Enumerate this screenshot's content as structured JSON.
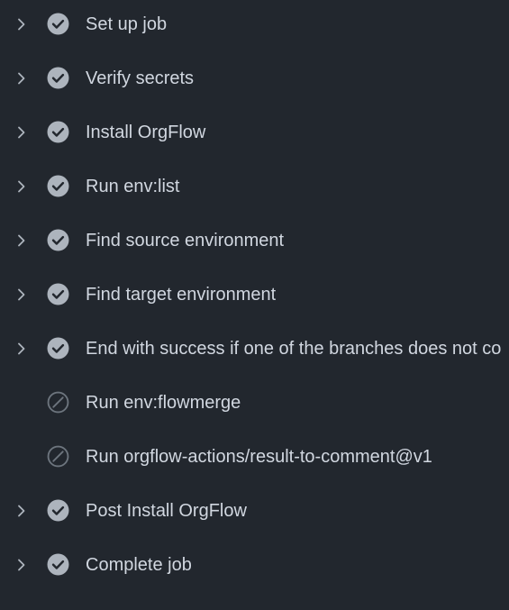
{
  "colors": {
    "background": "#22272e",
    "text": "#d1d7e0",
    "icon": "#adb4bd",
    "skipped_icon": "#6d757e"
  },
  "steps": [
    {
      "label": "Set up job",
      "status": "success",
      "expandable": true
    },
    {
      "label": "Verify secrets",
      "status": "success",
      "expandable": true
    },
    {
      "label": "Install OrgFlow",
      "status": "success",
      "expandable": true
    },
    {
      "label": "Run env:list",
      "status": "success",
      "expandable": true
    },
    {
      "label": "Find source environment",
      "status": "success",
      "expandable": true
    },
    {
      "label": "Find target environment",
      "status": "success",
      "expandable": true
    },
    {
      "label": "End with success if one of the branches does not co",
      "status": "success",
      "expandable": true
    },
    {
      "label": "Run env:flowmerge",
      "status": "skipped",
      "expandable": false
    },
    {
      "label": "Run orgflow-actions/result-to-comment@v1",
      "status": "skipped",
      "expandable": false
    },
    {
      "label": "Post Install OrgFlow",
      "status": "success",
      "expandable": true
    },
    {
      "label": "Complete job",
      "status": "success",
      "expandable": true
    }
  ]
}
